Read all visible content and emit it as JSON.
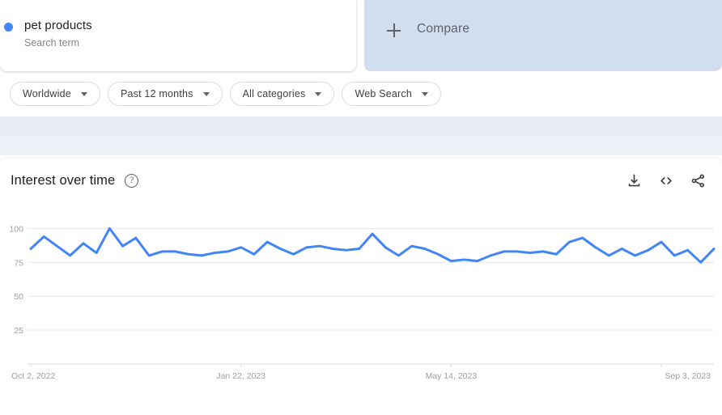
{
  "search_term": {
    "title": "pet products",
    "subtitle": "Search term",
    "dot_color": "#4285f4",
    "dot_icon": "legend-dot-icon"
  },
  "compare": {
    "label": "Compare",
    "icon": "plus-icon",
    "background": "#d2deef"
  },
  "filters": [
    {
      "name": "location",
      "label": "Worldwide"
    },
    {
      "name": "time-range",
      "label": "Past 12 months"
    },
    {
      "name": "category",
      "label": "All categories"
    },
    {
      "name": "search-type",
      "label": "Web Search"
    }
  ],
  "chart_header": {
    "title": "Interest over time",
    "help_icon": "help-circle-icon",
    "actions": [
      {
        "name": "download",
        "icon": "download-icon"
      },
      {
        "name": "embed",
        "icon": "embed-code-icon"
      },
      {
        "name": "share",
        "icon": "share-icon"
      }
    ]
  },
  "chart_data": {
    "type": "line",
    "title": "Interest over time",
    "xlabel": "",
    "ylabel": "",
    "ylim": [
      0,
      105
    ],
    "yticks": [
      25,
      50,
      75,
      100
    ],
    "ytick_labels": [
      "25",
      "50",
      "75",
      "100"
    ],
    "grid": true,
    "legend_position": "top-left",
    "line_color": "#4285f4",
    "series_name": "pet products",
    "xtick_labels": [
      "Oct 2, 2022",
      "Jan 22, 2023",
      "May 14, 2023",
      "Sep 3, 2023"
    ],
    "xtick_indices": [
      0,
      16,
      32,
      48
    ],
    "x": [
      "Oct 2, 2022",
      "Oct 9, 2022",
      "Oct 16, 2022",
      "Oct 23, 2022",
      "Oct 30, 2022",
      "Nov 6, 2022",
      "Nov 13, 2022",
      "Nov 20, 2022",
      "Nov 27, 2022",
      "Dec 4, 2022",
      "Dec 11, 2022",
      "Dec 18, 2022",
      "Dec 25, 2022",
      "Jan 1, 2023",
      "Jan 8, 2023",
      "Jan 15, 2023",
      "Jan 22, 2023",
      "Jan 29, 2023",
      "Feb 5, 2023",
      "Feb 12, 2023",
      "Feb 19, 2023",
      "Feb 26, 2023",
      "Mar 5, 2023",
      "Mar 12, 2023",
      "Mar 19, 2023",
      "Mar 26, 2023",
      "Apr 2, 2023",
      "Apr 9, 2023",
      "Apr 16, 2023",
      "Apr 23, 2023",
      "Apr 30, 2023",
      "May 7, 2023",
      "May 14, 2023",
      "May 21, 2023",
      "May 28, 2023",
      "Jun 4, 2023",
      "Jun 11, 2023",
      "Jun 18, 2023",
      "Jun 25, 2023",
      "Jul 2, 2023",
      "Jul 9, 2023",
      "Jul 16, 2023",
      "Jul 23, 2023",
      "Jul 30, 2023",
      "Aug 6, 2023",
      "Aug 13, 2023",
      "Aug 20, 2023",
      "Aug 27, 2023",
      "Sep 3, 2023",
      "Sep 10, 2023",
      "Sep 17, 2023",
      "Sep 24, 2023",
      "Oct 1, 2023"
    ],
    "values": [
      85,
      94,
      87,
      80,
      89,
      82,
      100,
      87,
      93,
      80,
      83,
      83,
      81,
      80,
      82,
      83,
      86,
      81,
      90,
      85,
      81,
      86,
      87,
      85,
      84,
      85,
      96,
      86,
      80,
      87,
      85,
      81,
      76,
      77,
      76,
      80,
      83,
      83,
      82,
      83,
      81,
      90,
      93,
      86,
      80,
      85,
      80,
      84,
      90,
      80,
      84,
      75,
      85
    ]
  }
}
